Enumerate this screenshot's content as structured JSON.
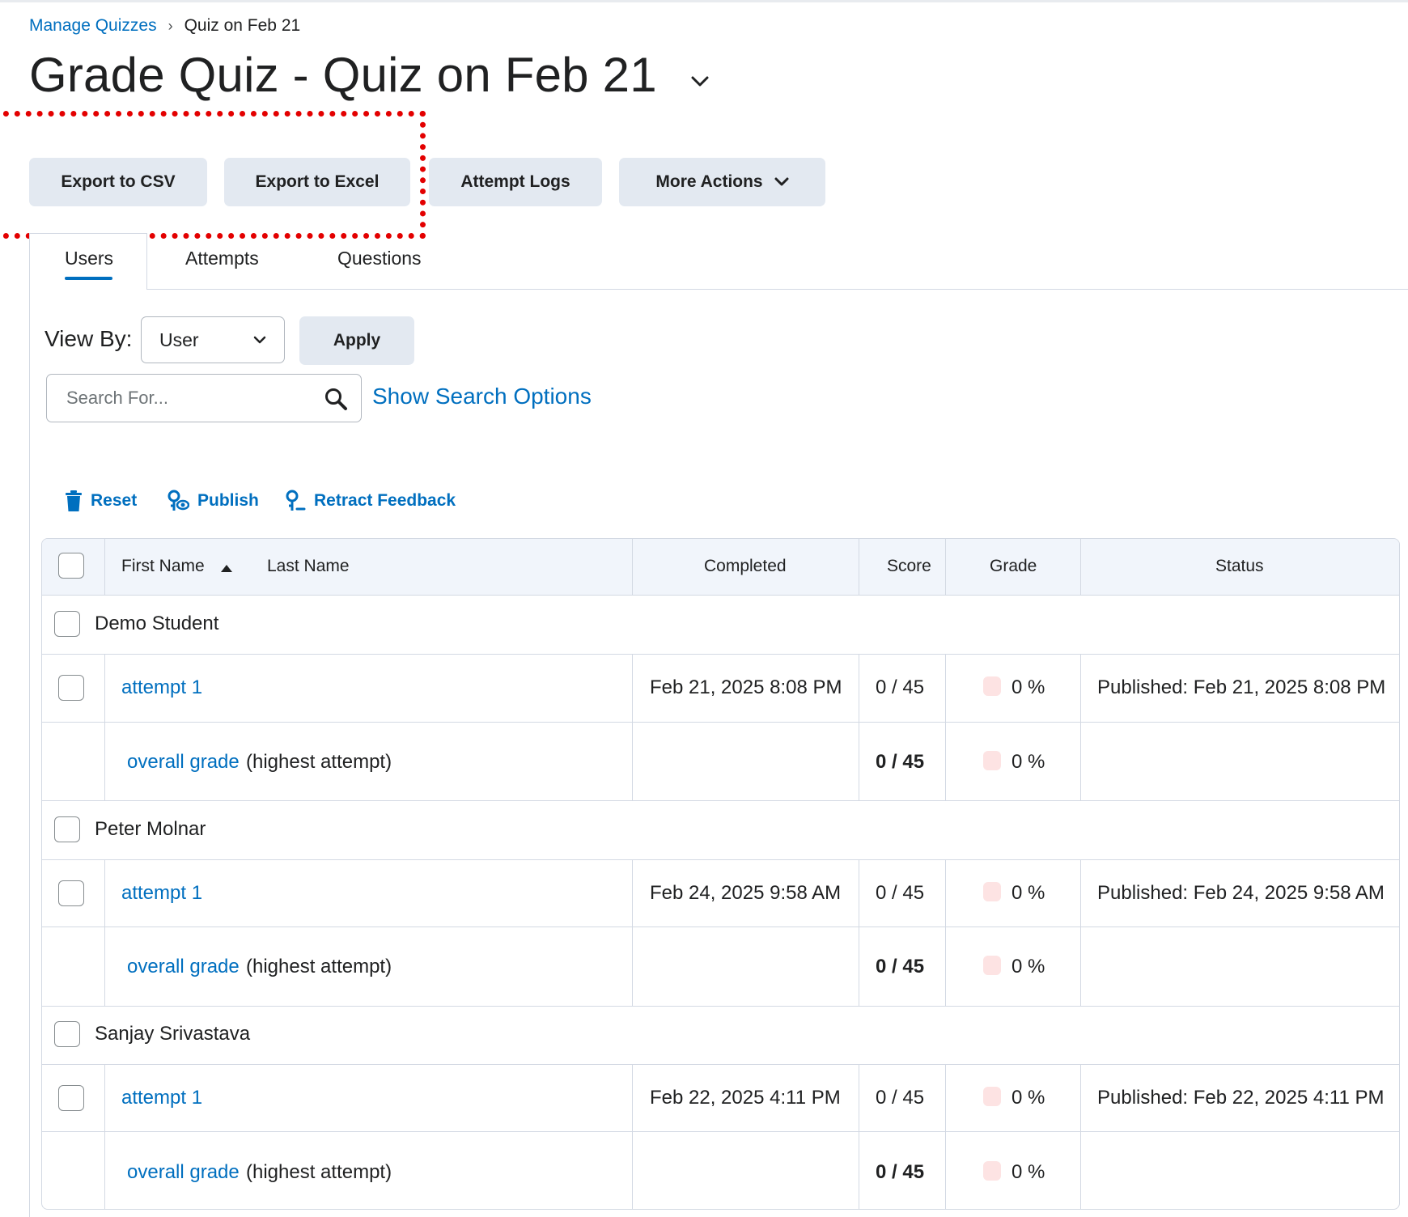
{
  "breadcrumb": {
    "parent": "Manage Quizzes",
    "separator": "›",
    "current": "Quiz on Feb 21"
  },
  "page": {
    "title": "Grade Quiz - Quiz on Feb 21"
  },
  "toolbar": {
    "export_csv": "Export to CSV",
    "export_excel": "Export to Excel",
    "attempt_logs": "Attempt Logs",
    "more_actions": "More Actions"
  },
  "tabs": [
    {
      "label": "Users",
      "active": true
    },
    {
      "label": "Attempts"
    },
    {
      "label": "Questions"
    }
  ],
  "view_by": {
    "label": "View By:",
    "selected": "User",
    "apply_label": "Apply"
  },
  "search": {
    "placeholder": "Search For...",
    "show_options": "Show Search Options"
  },
  "actions": {
    "reset": "Reset",
    "publish": "Publish",
    "retract": "Retract Feedback"
  },
  "table": {
    "headers": {
      "first_name": "First Name",
      "last_name": "Last Name",
      "completed": "Completed",
      "score": "Score",
      "grade": "Grade",
      "status": "Status"
    },
    "groups": [
      {
        "student": "Demo Student",
        "attempt": {
          "label": "attempt 1",
          "completed": "Feb 21, 2025 8:08 PM",
          "score": "0 / 45",
          "grade": "0 %",
          "status": "Published: Feb 21, 2025 8:08 PM"
        },
        "overall": {
          "label": "overall grade",
          "note": "(highest attempt)",
          "score": "0 / 45",
          "grade": "0 %"
        }
      },
      {
        "student": "Peter Molnar",
        "attempt": {
          "label": "attempt 1",
          "completed": "Feb 24, 2025 9:58 AM",
          "score": "0 / 45",
          "grade": "0 %",
          "status": "Published: Feb 24, 2025 9:58 AM"
        },
        "overall": {
          "label": "overall grade",
          "note": "(highest attempt)",
          "score": "0 / 45",
          "grade": "0 %"
        }
      },
      {
        "student": "Sanjay Srivastava",
        "attempt": {
          "label": "attempt 1",
          "completed": "Feb 22, 2025 4:11 PM",
          "score": "0 / 45",
          "grade": "0 %",
          "status": "Published: Feb 22, 2025 4:11 PM"
        },
        "overall": {
          "label": "overall grade",
          "note": "(highest attempt)",
          "score": "0 / 45",
          "grade": "0 %"
        }
      }
    ]
  },
  "colors": {
    "link": "#006fbf",
    "button_bg": "#e3e9f1",
    "header_bg": "#f1f5fb",
    "highlight": "#e30000",
    "grade_swatch": "#fde3e3"
  }
}
